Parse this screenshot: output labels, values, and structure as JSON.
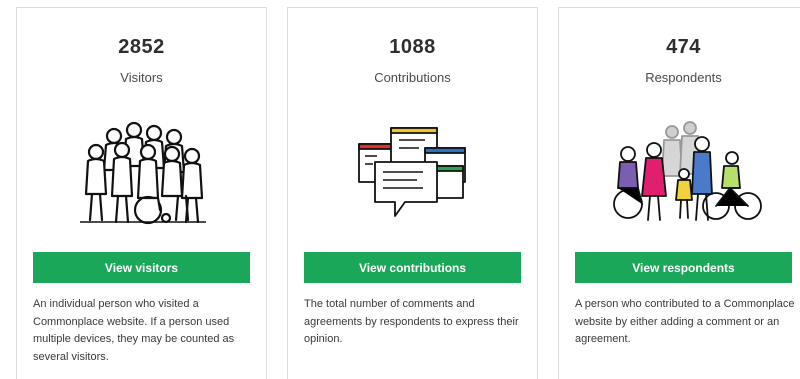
{
  "cards": [
    {
      "value": "2852",
      "label": "Visitors",
      "button_label": "View visitors",
      "description": "An individual person who visited a Commonplace website. If a person used multiple devices, they may be counted as several visitors.",
      "illustration_icon": "crowd-icon"
    },
    {
      "value": "1088",
      "label": "Contributions",
      "button_label": "View contributions",
      "description": "The total number of comments and agreements by respondents to express their opinion.",
      "illustration_icon": "comment-bubbles-icon"
    },
    {
      "value": "474",
      "label": "Respondents",
      "button_label": "View respondents",
      "description": "A person who contributed to a Commonplace website by either adding a comment or an agreement.",
      "illustration_icon": "respondents-icon"
    }
  ],
  "colors": {
    "button": "#1aa75a",
    "card_border": "#dcdcdc"
  }
}
